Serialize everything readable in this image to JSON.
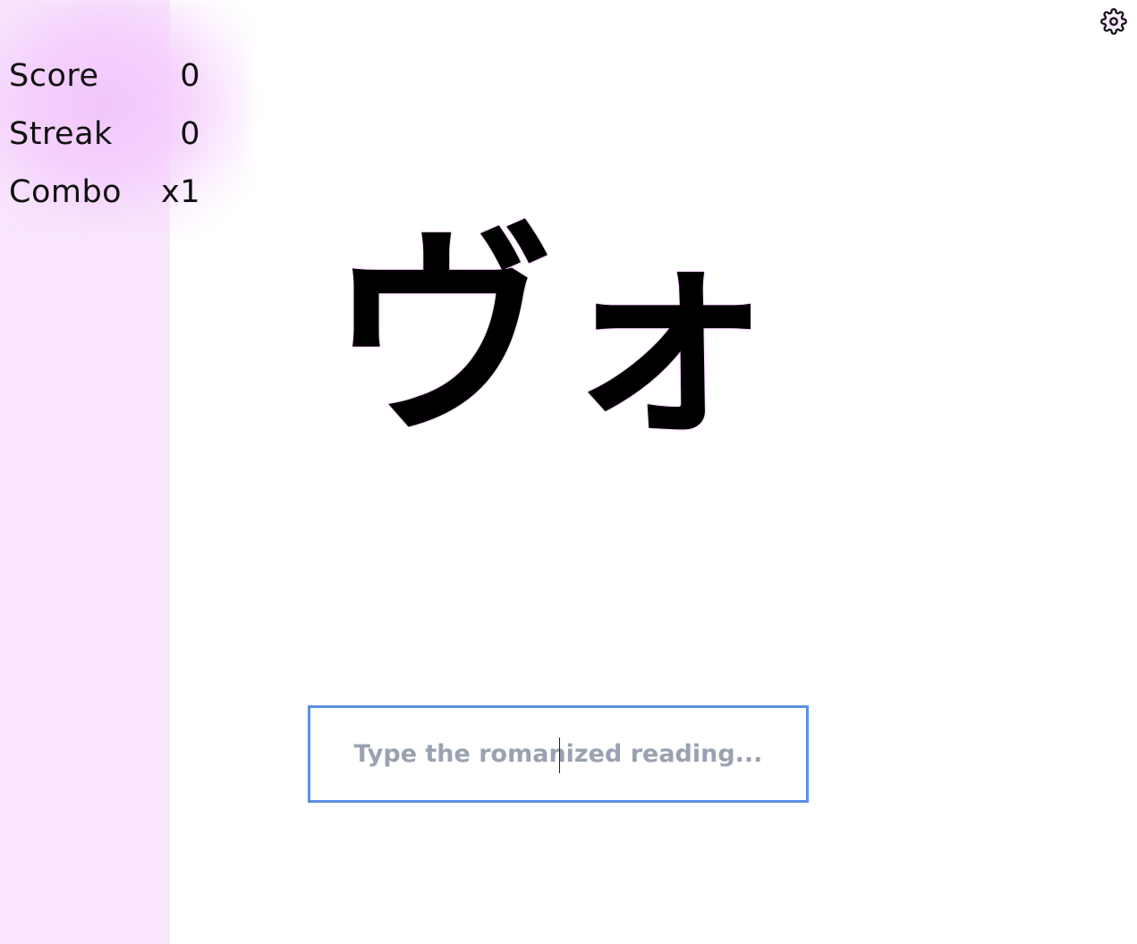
{
  "stats": [
    {
      "label": "Score",
      "value": "0"
    },
    {
      "label": "Streak",
      "value": "0"
    },
    {
      "label": "Combo",
      "value": "x1"
    }
  ],
  "prompt": {
    "kana": "ヴォ"
  },
  "answer": {
    "placeholder": "Type the romanized reading...",
    "value": ""
  },
  "icons": {
    "settings": "gear-icon"
  },
  "colors": {
    "sidebar": "#f9e6fd",
    "glow": "#f1c4fc",
    "input_border": "#5b8fe4",
    "placeholder": "#9aa2b1",
    "kana": "#000000"
  }
}
